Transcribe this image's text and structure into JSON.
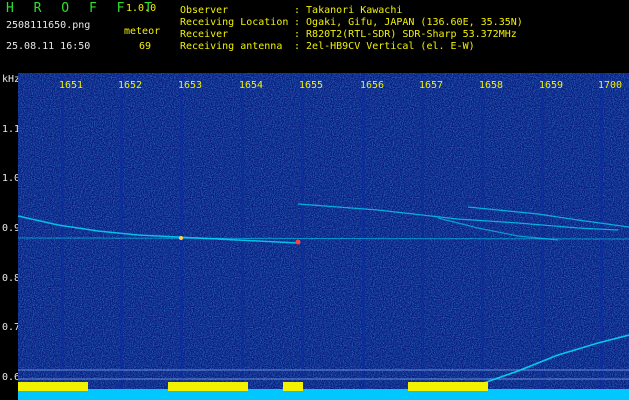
{
  "header": {
    "app_name": "H R O F F T",
    "version": "1.0.0",
    "filename": "2508111650.png",
    "datetime": "25.08.11 16:50",
    "meteor_label": "meteor",
    "meteor_count": "69",
    "observer_label": "Observer",
    "observer_value": ": Takanori Kawachi",
    "location_label": "Receiving Location",
    "location_value": ": Ogaki, Gifu, JAPAN (136.60E, 35.35N)",
    "receiver_label": "Receiver",
    "receiver_value": ": R820T2(RTL-SDR) SDR-Sharp 53.372MHz",
    "antenna_label": "Receiving antenna",
    "antenna_value": ": 2el-HB9CV Vertical (el. E-W)"
  },
  "axis": {
    "unit": "kHz",
    "time_ticks": [
      "1651",
      "1652",
      "1653",
      "1654",
      "1655",
      "1656",
      "1657",
      "1658",
      "1659",
      "1700"
    ],
    "freq_ticks": [
      "1.1",
      "1.0",
      "0.9",
      "0.8",
      "0.7",
      "0.6"
    ]
  },
  "colors": {
    "background": "#061a7a",
    "text_green": "#2ee02e",
    "text_yellow": "#f2f200",
    "signal_cyan": "#00e5ff",
    "level_bar": "#00c8ff",
    "level_peak": "#f2f200"
  }
}
